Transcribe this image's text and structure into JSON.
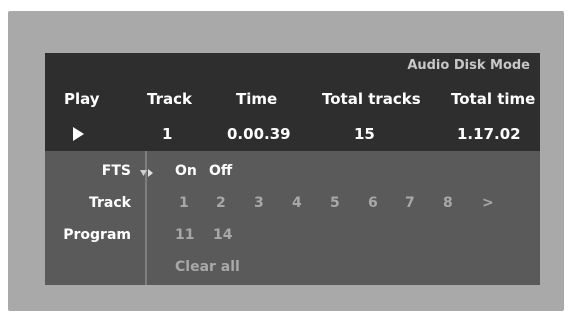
{
  "mode_label": "Audio Disk Mode",
  "status": {
    "headers": {
      "play": "Play",
      "track": "Track",
      "time": "Time",
      "total_tracks": "Total tracks",
      "total_time": "Total time"
    },
    "values": {
      "track": "1",
      "time": "0.00.39",
      "total_tracks": "15",
      "total_time": "1.17.02"
    }
  },
  "menu": {
    "fts": {
      "label": "FTS",
      "on": "On",
      "off": "Off"
    },
    "track": {
      "label": "Track",
      "numbers": [
        "1",
        "2",
        "3",
        "4",
        "5",
        "6",
        "7",
        "8",
        ">"
      ]
    },
    "program": {
      "label": "Program",
      "items": [
        "11",
        "14"
      ],
      "clear": "Clear all"
    }
  },
  "colors": {
    "frame": "#a9a9a9",
    "panel": "#5a5a5a",
    "status_bar": "#2e2e2e",
    "dim_text": "#a8a8a8"
  }
}
